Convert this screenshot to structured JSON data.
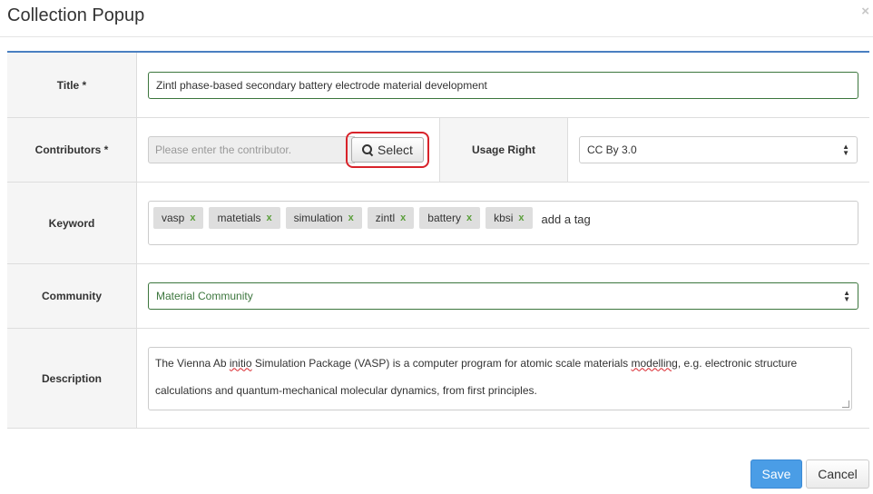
{
  "modal": {
    "title": "Collection Popup",
    "close_glyph": "×"
  },
  "form": {
    "title_label": "Title *",
    "title_value": "Zintl phase-based secondary battery electrode material development",
    "contributors_label": "Contributors *",
    "contributors_placeholder": "Please enter the contributor.",
    "select_button": "Select",
    "usage_right_label": "Usage Right",
    "usage_right_value": "CC By 3.0",
    "keyword_label": "Keyword",
    "tags": [
      "vasp",
      "matetials",
      "simulation",
      "zintl",
      "battery",
      "kbsi"
    ],
    "tag_remove": "x",
    "add_tag_placeholder": "add a tag",
    "community_label": "Community",
    "community_value": "Material Community",
    "description_label": "Description",
    "description_parts": {
      "a": "The Vienna Ab ",
      "b": "initio",
      "c": " Simulation Package (VASP) is a computer program for atomic scale materials ",
      "d": "modelling",
      "e": ", e.g. electronic structure",
      "line2": "calculations and quantum-mechanical molecular dynamics, from first principles."
    }
  },
  "footer": {
    "save": "Save",
    "cancel": "Cancel"
  },
  "colors": {
    "accent": "#4a7fc1",
    "valid_green": "#3c763d",
    "highlight_red": "#d8232a",
    "save_blue": "#4a9de6"
  }
}
